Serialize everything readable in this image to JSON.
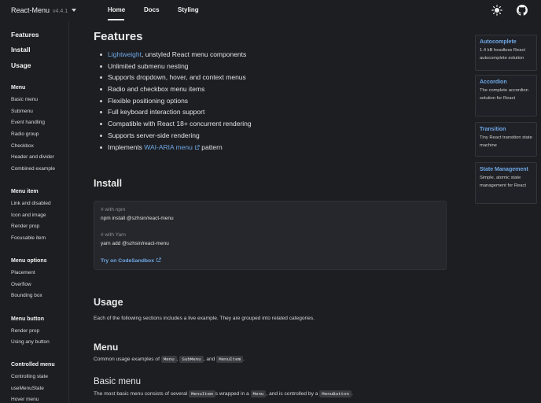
{
  "header": {
    "brand": "React-Menu",
    "version": "v4.4.1",
    "nav": [
      "Home",
      "Docs",
      "Styling"
    ]
  },
  "sidebar": {
    "top_links": [
      "Features",
      "Install",
      "Usage"
    ],
    "groups": [
      {
        "title": "Menu",
        "items": [
          "Basic menu",
          "Submenu",
          "Event handling",
          "Radio group",
          "Checkbox",
          "Header and divider",
          "Combined example"
        ]
      },
      {
        "title": "Menu item",
        "items": [
          "Link and disabled",
          "Icon and image",
          "Render prop",
          "Focusable item"
        ]
      },
      {
        "title": "Menu options",
        "items": [
          "Placement",
          "Overflow",
          "Bounding box"
        ]
      },
      {
        "title": "Menu button",
        "items": [
          "Render prop",
          "Using any button"
        ]
      },
      {
        "title": "Controlled menu",
        "items": [
          "Controlling state",
          "useMenuState",
          "Hover menu"
        ]
      }
    ]
  },
  "main": {
    "features_title": "Features",
    "features": {
      "lightweight": "Lightweight",
      "first_rest": ", unstyled React menu components",
      "items": [
        "Unlimited submenu nesting",
        "Supports dropdown, hover, and context menus",
        "Radio and checkbox menu items",
        "Flexible positioning options",
        "Full keyboard interaction support",
        "Compatible with React 18+ concurrent rendering",
        "Supports server-side rendering"
      ],
      "last_pre": "Implements ",
      "last_link": "WAI-ARIA menu",
      "last_post": " pattern"
    },
    "install_title": "Install",
    "install": {
      "npm_comment": "# with npm",
      "npm_cmd": "npm install @szhsin/react-menu",
      "yarn_comment": "# with Yarn",
      "yarn_cmd": "yarn add @szhsin/react-menu",
      "sandbox_link": "Try on CodeSandbox"
    },
    "usage_title": "Usage",
    "usage_text": "Each of the following sections includes a live example. They are grouped into related categories.",
    "menu_title": "Menu",
    "menu_text": {
      "pre": "Common usage examples of ",
      "code1": "Menu",
      "sep1": ", ",
      "code2": "SubMenu",
      "sep2": ", and ",
      "code3": "MenuItem",
      "post": "."
    },
    "basic_title": "Basic menu",
    "basic_text": {
      "pre": "The most basic menu consists of several ",
      "code1": "MenuItem",
      "mid1": "s wrapped in a ",
      "code2": "Menu",
      "mid2": ", and is controlled by a ",
      "code3": "MenuButton",
      "post": "."
    }
  },
  "cards": [
    {
      "title": "Autocomplete",
      "desc": "1.4 kB headless React autocomplete solution"
    },
    {
      "title": "Accordion",
      "desc": "The complete accordion solution for React"
    },
    {
      "title": "Transition",
      "desc": "Tiny React transition state machine"
    },
    {
      "title": "State Management",
      "desc": "Simple, atomic state management for React"
    }
  ],
  "icons": {
    "theme": "sun-icon",
    "repo": "github-icon",
    "external": "external-link-icon"
  },
  "colors": {
    "background": "#1d1e22",
    "link": "#6ea8e6",
    "code_bg": "#26272c"
  }
}
